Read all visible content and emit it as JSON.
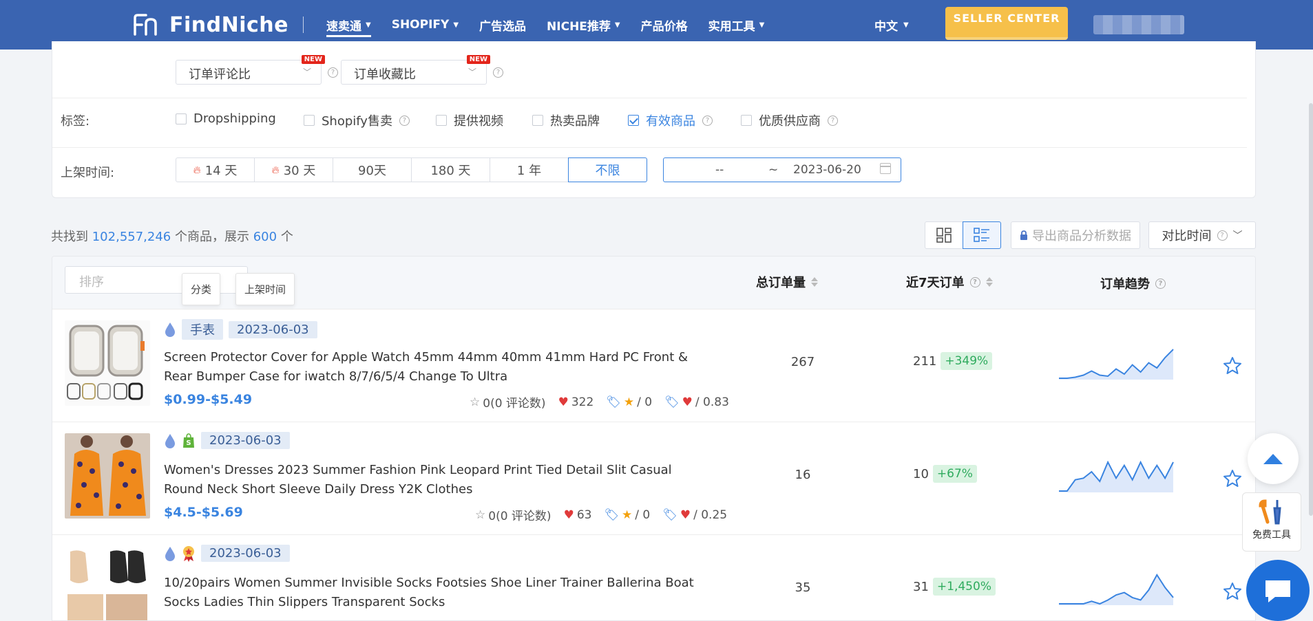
{
  "header": {
    "logo_text": "FindNiche",
    "nav": [
      {
        "label": "速卖通",
        "caret": true,
        "active": true
      },
      {
        "label": "SHOPIFY",
        "caret": true
      },
      {
        "label": "广告选品",
        "caret": false
      },
      {
        "label": "NICHE推荐",
        "caret": true
      },
      {
        "label": "产品价格",
        "caret": false
      },
      {
        "label": "实用工具",
        "caret": true
      }
    ],
    "lang": "中文",
    "seller_center": "SELLER CENTER",
    "brand_color": "#3a64b1",
    "accent_color": "#3a84e0"
  },
  "filters": {
    "select1": "订单评论比",
    "select2": "订单收藏比",
    "new_badge": "NEW",
    "tags_label": "标签:",
    "tags": [
      {
        "label": "Dropshipping",
        "checked": false,
        "help": false
      },
      {
        "label": "Shopify售卖",
        "checked": false,
        "help": true
      },
      {
        "label": "提供视频",
        "checked": false,
        "help": false
      },
      {
        "label": "热卖品牌",
        "checked": false,
        "help": false
      },
      {
        "label": "有效商品",
        "checked": true,
        "help": true
      },
      {
        "label": "优质供应商",
        "checked": false,
        "help": true
      }
    ],
    "time_label": "上架时间:",
    "time_options": [
      {
        "label": "14 天",
        "fire": true
      },
      {
        "label": "30 天",
        "fire": true
      },
      {
        "label": "90天",
        "fire": false
      },
      {
        "label": "180 天",
        "fire": false
      },
      {
        "label": "1 年",
        "fire": false
      },
      {
        "label": "不限",
        "fire": false,
        "active": true
      }
    ],
    "date_from": "--",
    "date_sep": "~",
    "date_to": "2023-06-20"
  },
  "summary": {
    "prefix": "共找到",
    "total": "102,557,246",
    "middle": "个商品，展示",
    "shown": "600",
    "suffix": "个"
  },
  "toolbar": {
    "export_label": "导出商品分析数据",
    "compare_label": "对比时间"
  },
  "table": {
    "sort_placeholder": "排序",
    "tooltip_category": "分类",
    "tooltip_date": "上架时间",
    "col_total": "总订单量",
    "col_recent": "近7天订单",
    "col_trend": "订单趋势",
    "rows": [
      {
        "category": "手表",
        "date": "2023-06-03",
        "title": "Screen Protector Cover for Apple Watch 45mm 44mm 40mm 41mm Hard PC Front & Rear Bumper Case for iwatch 8/7/6/5/4 Change To Ultra",
        "price": "$0.99-$5.49",
        "reviews": "0(0 评论数)",
        "likes": "322",
        "stars": "/ 0",
        "ratio": "/ 0.83",
        "total_orders": "267",
        "recent_orders": "211",
        "growth": "+349%",
        "trend": [
          2,
          2,
          3,
          5,
          9,
          5,
          4,
          11,
          6,
          15,
          8,
          17,
          12,
          22,
          30
        ]
      },
      {
        "category": "",
        "date": "2023-06-03",
        "title": "Women's Dresses 2023 Summer Fashion Pink Leopard Print Tied Detail Slit Casual Round Neck Short Sleeve Daily Dress Y2K Clothes",
        "price": "$4.5-$5.69",
        "reviews": "0(0 评论数)",
        "likes": "63",
        "stars": "/ 0",
        "ratio": "/ 0.25",
        "total_orders": "16",
        "recent_orders": "10",
        "growth": "+67%",
        "trend": [
          2,
          2,
          9,
          10,
          14,
          8,
          20,
          10,
          18,
          9,
          20,
          10,
          18,
          10,
          20
        ]
      },
      {
        "category": "",
        "date": "2023-06-03",
        "title": "10/20pairs Women Summer Invisible Socks Footsies Shoe Liner Trainer Ballerina Boat Socks Ladies Thin Slippers Transparent Socks",
        "price": "",
        "reviews": "",
        "likes": "",
        "stars": "",
        "ratio": "",
        "total_orders": "35",
        "recent_orders": "31",
        "growth": "+1,450%",
        "trend": [
          1,
          1,
          1,
          1,
          3,
          1,
          4,
          8,
          10,
          6,
          4,
          12,
          24,
          14,
          6
        ]
      }
    ]
  },
  "widgets": {
    "tools_label": "免费工具"
  }
}
